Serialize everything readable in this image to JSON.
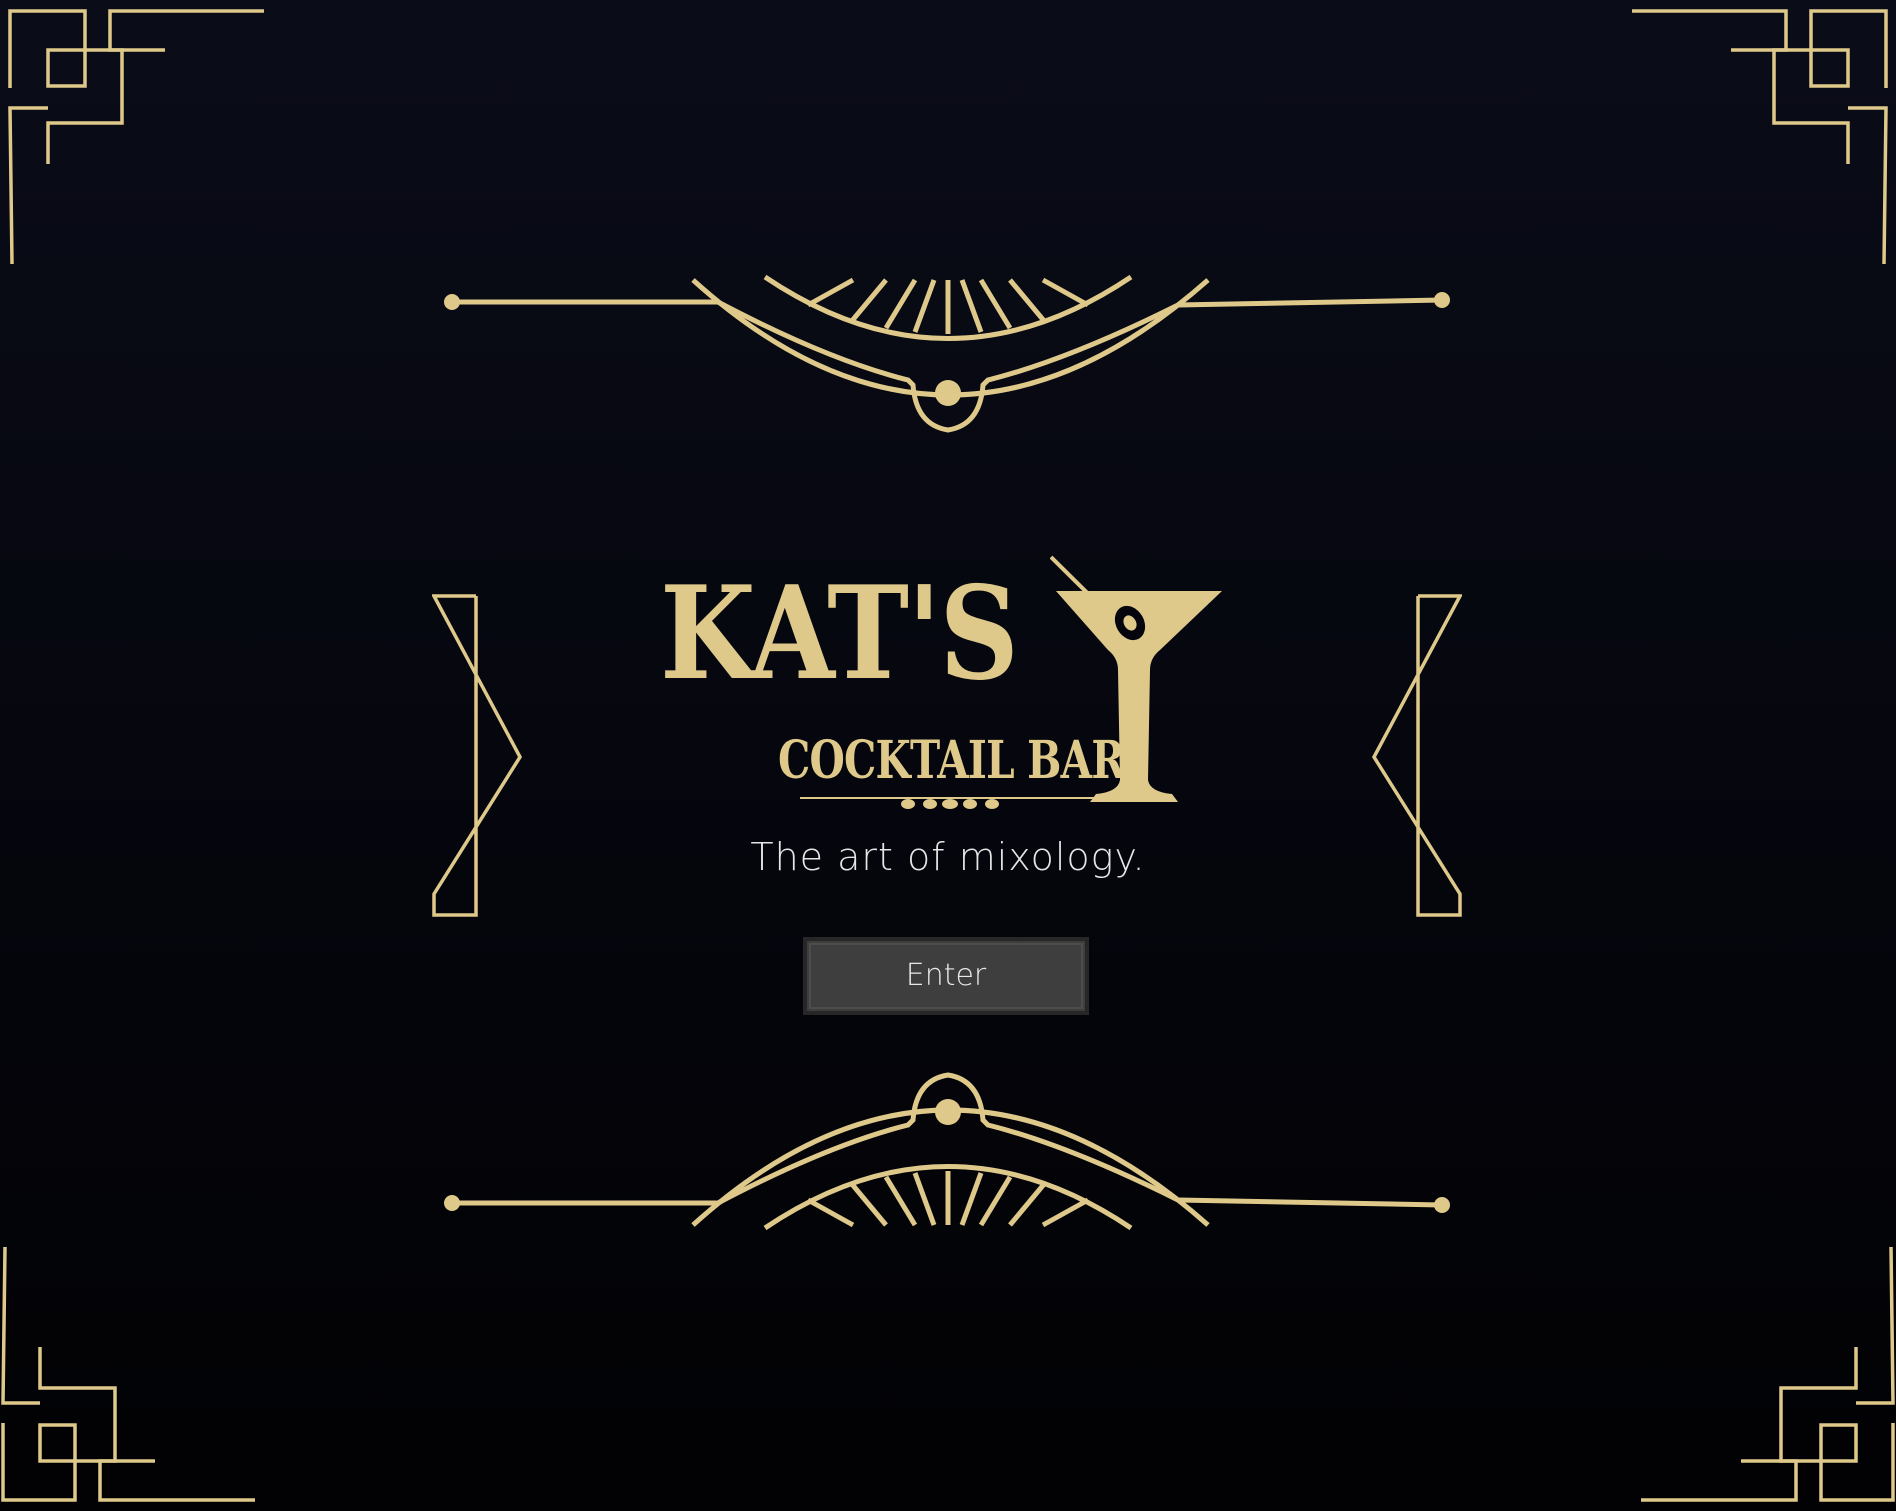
{
  "brand": {
    "title": "KAT'S",
    "subtitle": "COCKTAIL BAR",
    "tagline": "The art of mixology."
  },
  "actions": {
    "enter_label": "Enter"
  },
  "theme": {
    "gold": "#dfc98a",
    "background": "#05060d",
    "button_bg": "#3e3e3e",
    "button_text": "#e8e8e8"
  }
}
